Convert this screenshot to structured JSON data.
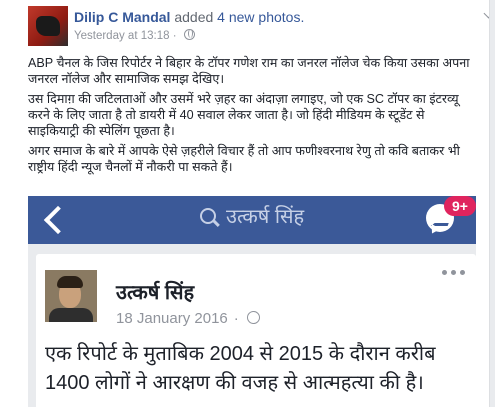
{
  "post": {
    "author": "Dilip C Mandal",
    "action": "added",
    "photo_count": "4 new photos.",
    "timestamp": "Yesterday at 13:18",
    "separator": "·",
    "paragraphs": [
      "ABP चैनल के जिस रिपोर्टर ने बिहार के टॉपर गणेश राम का जनरल नॉलेज चेक किया उसका अपना जनरल नॉलेज और सामाजिक समझ देखिए।",
      "उस दिमाग़ की जटिलताओं और उसमें भरे ज़हर का अंदाज़ा लगाइए, जो एक SC टॉपर का इंटरव्यू करने के लिए जाता है तो डायरी में 40 सवाल लेकर जाता है। जो हिंदी मीडियम के स्टूडेंट से साइकियाट्री की स्पेलिंग पूछता है।",
      "अगर समाज के बारे में आपके ऐसे ज़हरीले विचार हैं तो आप फणीश्वरनाथ रेणु तो कवि बताकर भी राष्ट्रीय हिंदी न्यूज चैनलों में नौकरी पा सकते हैं।"
    ]
  },
  "screenshot": {
    "search_text": "उत्कर्ष सिंह",
    "badge": "9+",
    "card": {
      "name": "उत्कर्ष सिंह",
      "date": "18 January 2016",
      "separator": "·",
      "text": "एक रिपोर्ट के मुताबिक 2004 से 2015 के दौरान करीब 1400 लोगों ने आरक्षण की वजह से आत्महत्या की है।"
    }
  },
  "colors": {
    "fb_blue": "#3b5998",
    "link_blue": "#365899",
    "badge_red": "#e0245e"
  }
}
